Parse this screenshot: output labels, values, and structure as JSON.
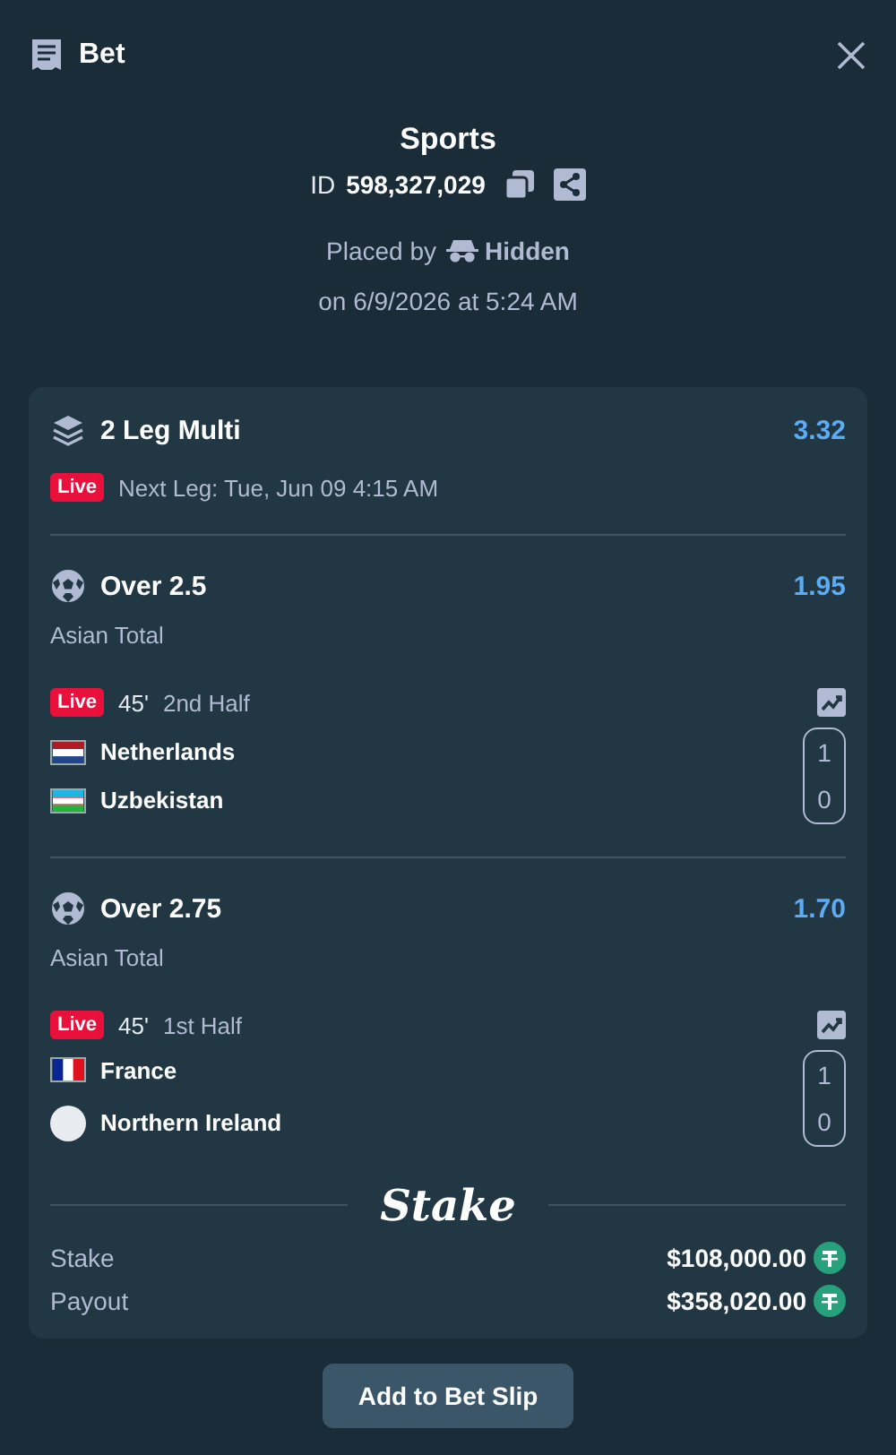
{
  "header": {
    "title": "Bet"
  },
  "summary": {
    "title": "Sports",
    "id_label": "ID",
    "id_value": "598,327,029",
    "placed_by_label": "Placed by",
    "placed_by_user": "Hidden",
    "placed_on": "on 6/9/2026 at 5:24 AM"
  },
  "multi": {
    "title": "2 Leg Multi",
    "odds": "3.32",
    "live_badge": "Live",
    "next_leg": "Next Leg: Tue, Jun 09 4:15 AM"
  },
  "legs": [
    {
      "selection": "Over 2.5",
      "odds": "1.95",
      "market": "Asian Total",
      "live_badge": "Live",
      "minute": "45'",
      "period": "2nd Half",
      "teams": [
        {
          "name": "Netherlands",
          "kind": "netherlands",
          "score": "1"
        },
        {
          "name": "Uzbekistan",
          "kind": "uzbekistan",
          "score": "0"
        }
      ]
    },
    {
      "selection": "Over 2.75",
      "odds": "1.70",
      "market": "Asian Total",
      "live_badge": "Live",
      "minute": "45'",
      "period": "1st Half",
      "teams": [
        {
          "name": "France",
          "kind": "france",
          "score": "1"
        },
        {
          "name": "Northern Ireland",
          "kind": "blank",
          "score": "0"
        }
      ]
    }
  ],
  "logo": "Stake",
  "totals": [
    {
      "label": "Stake",
      "amount": "$108,000.00"
    },
    {
      "label": "Payout",
      "amount": "$358,020.00"
    }
  ],
  "button": "Add to Bet Slip"
}
